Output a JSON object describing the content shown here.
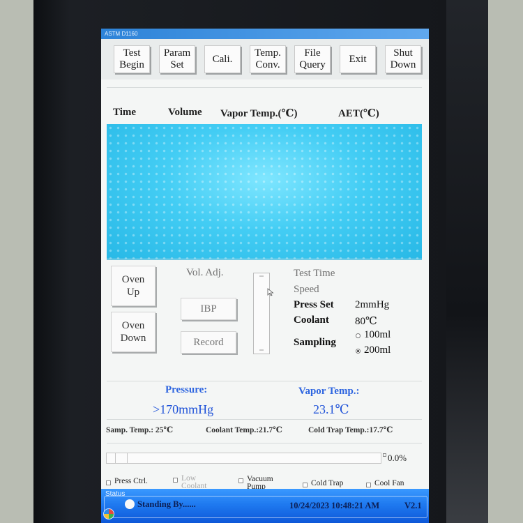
{
  "window": {
    "title": "ASTM D1160"
  },
  "toolbar": {
    "buttons": [
      {
        "label": "Test\nBegin"
      },
      {
        "label": "Param\nSet"
      },
      {
        "label": "Cali."
      },
      {
        "label": "Temp.\nConv."
      },
      {
        "label": "File\nQuery"
      },
      {
        "label": "Exit"
      },
      {
        "label": "Shut\nDown"
      }
    ]
  },
  "table": {
    "columns": [
      "Time",
      "Volume",
      "Vapor Temp.(℃)",
      "AET(℃)"
    ],
    "rows": []
  },
  "controls": {
    "oven_up": "Oven\nUp",
    "oven_down": "Oven\nDown",
    "vol_adj_label": "Vol. Adj.",
    "ibp_button": "IBP",
    "record_button": "Record"
  },
  "params": {
    "test_time_label": "Test Time",
    "speed_label": "Speed",
    "press_set_label": "Press Set",
    "press_set_value": "2mmHg",
    "coolant_label": "Coolant",
    "coolant_value": "80℃",
    "sampling_label": "Sampling",
    "sampling_options": [
      "100ml",
      "200ml"
    ],
    "sampling_selected": "200ml"
  },
  "readouts": {
    "pressure_label": "Pressure:",
    "pressure_value": ">170mmHg",
    "vapor_temp_label": "Vapor Temp.:",
    "vapor_temp_value": "23.1℃"
  },
  "temps": {
    "samp_temp": "Samp. Temp.: 25℃",
    "coolant_temp": "Coolant Temp.:21.7℃",
    "cold_trap_temp": "Cold Trap Temp.:17.7℃"
  },
  "progress": {
    "value_pct": 0.0,
    "label": "0.0%"
  },
  "toggles": [
    {
      "label": "Press Ctrl.",
      "enabled": true,
      "checked": false
    },
    {
      "label": "Low\nCoolant",
      "enabled": false,
      "checked": false
    },
    {
      "label": "Vacuum\nPump",
      "enabled": true,
      "checked": false
    },
    {
      "label": "Cold Trap",
      "enabled": true,
      "checked": false
    },
    {
      "label": "Cool Fan",
      "enabled": true,
      "checked": false
    }
  ],
  "status": {
    "caption": "Status",
    "message": "Standing By......",
    "datetime": "10/24/2023 10:48:21 AM",
    "version": "V2.1"
  },
  "colors": {
    "accent_blue": "#2f66e0",
    "table_bg": "#43cdf4",
    "status_bar": "#1f7af0"
  },
  "icons": {
    "start_orb": "windows-start-icon",
    "status_indicator": "status-dot-icon"
  }
}
